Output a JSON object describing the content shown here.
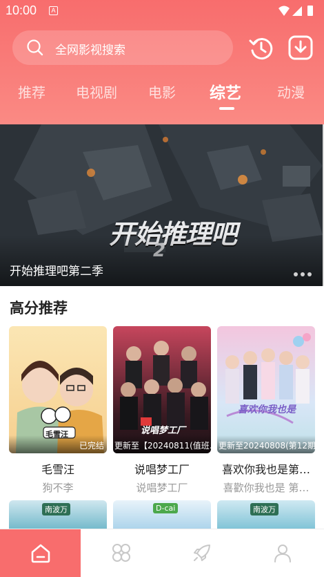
{
  "status": {
    "time": "10:00",
    "notification_letter": "A"
  },
  "search": {
    "placeholder": "全网影视搜索"
  },
  "header_actions": {
    "history_icon": "history-icon",
    "download_icon": "download-icon"
  },
  "tabs": [
    {
      "label": "推荐",
      "active": false
    },
    {
      "label": "电视剧",
      "active": false
    },
    {
      "label": "电影",
      "active": false
    },
    {
      "label": "综艺",
      "active": true
    },
    {
      "label": "动漫",
      "active": false
    }
  ],
  "banner": {
    "title": "开始推理吧第二季",
    "logo_text": "开始推理吧",
    "logo_number": "2"
  },
  "section": {
    "title": "高分推荐"
  },
  "cards": [
    {
      "title": "毛雪汪",
      "subtitle": "狗不李",
      "badge": "已完结",
      "poster_text": "毛雪汪"
    },
    {
      "title": "说唱梦工厂",
      "subtitle": "说唱梦工厂",
      "badge": "更新至【20240811(值班…",
      "poster_text": "说唱梦工厂"
    },
    {
      "title": "喜欢你我也是第…",
      "subtitle": "喜歡你我也是 第…",
      "badge": "更新至20240808(第12期…",
      "poster_text": "喜欢你我也是"
    }
  ],
  "row2": [
    {
      "label": "南波万"
    },
    {
      "label": "D-cai"
    },
    {
      "label": "南波万"
    }
  ],
  "bottom_nav": [
    {
      "name": "home",
      "icon": "home-icon",
      "active": true
    },
    {
      "name": "category",
      "icon": "grid-icon",
      "active": false
    },
    {
      "name": "discover",
      "icon": "rocket-icon",
      "active": false
    },
    {
      "name": "profile",
      "icon": "user-icon",
      "active": false
    }
  ],
  "colors": {
    "brand": "#f86d6d",
    "brand_light": "#fa8a84",
    "text_primary": "#222222",
    "text_secondary": "#999999"
  }
}
